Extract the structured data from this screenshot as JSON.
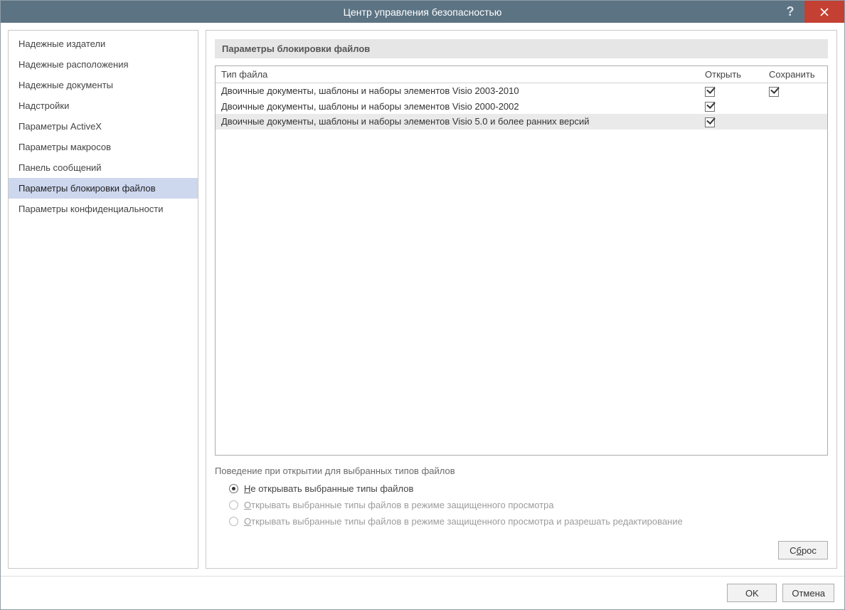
{
  "window": {
    "title": "Центр управления безопасностью"
  },
  "sidebar": {
    "items": [
      {
        "label": "Надежные издатели"
      },
      {
        "label": "Надежные расположения"
      },
      {
        "label": "Надежные документы"
      },
      {
        "label": "Надстройки"
      },
      {
        "label": "Параметры ActiveX"
      },
      {
        "label": "Параметры макросов"
      },
      {
        "label": "Панель сообщений"
      },
      {
        "label": "Параметры блокировки файлов",
        "selected": true
      },
      {
        "label": "Параметры конфиденциальности"
      }
    ]
  },
  "main": {
    "section_header": "Параметры блокировки файлов",
    "table": {
      "columns": {
        "type": "Тип файла",
        "open": "Открыть",
        "save": "Сохранить"
      },
      "rows": [
        {
          "type": "Двоичные документы, шаблоны и наборы элементов Visio 2003-2010",
          "open": true,
          "save": true
        },
        {
          "type": "Двоичные документы, шаблоны и наборы элементов Visio 2000-2002",
          "open": true,
          "save": false
        },
        {
          "type": "Двоичные документы, шаблоны и наборы элементов Visio 5.0 и более ранних версий",
          "open": true,
          "save": false,
          "highlight": true
        }
      ]
    },
    "behavior": {
      "title": "Поведение при открытии для выбранных типов файлов",
      "options": [
        {
          "label_prefix": "Н",
          "label_rest": "е открывать выбранные типы файлов",
          "selected": true,
          "disabled": false
        },
        {
          "label_prefix": "О",
          "label_rest": "ткрывать выбранные типы файлов в режиме защищенного просмотра",
          "selected": false,
          "disabled": true
        },
        {
          "label_prefix": "О",
          "label_rest": "ткрывать выбранные типы файлов в режиме защищенного просмотра и разрешать редактирование",
          "selected": false,
          "disabled": true
        }
      ]
    },
    "reset_prefix": "С",
    "reset_underline": "б",
    "reset_rest": "рос"
  },
  "footer": {
    "ok": "OK",
    "cancel": "Отмена"
  }
}
